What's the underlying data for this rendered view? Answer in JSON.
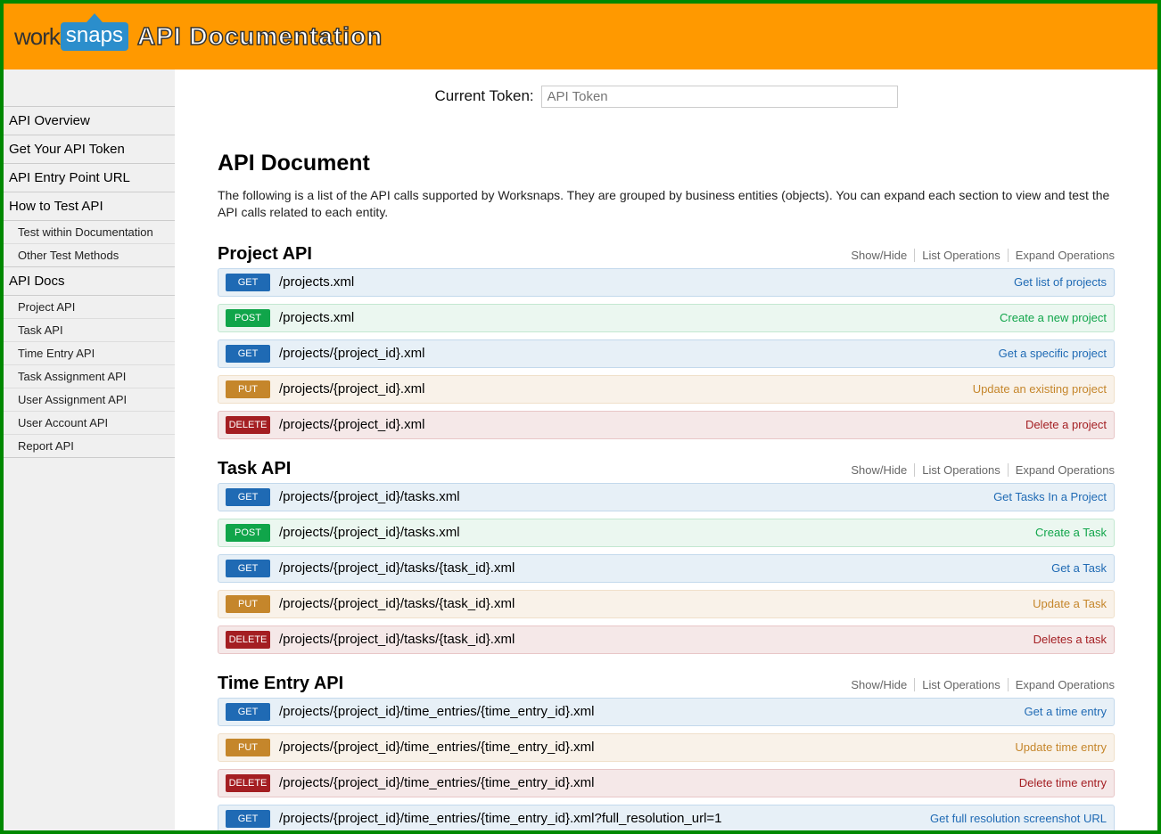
{
  "header": {
    "logo_left": "work",
    "logo_right": "snaps",
    "title": "API Documentation"
  },
  "sidebar": {
    "items": [
      {
        "type": "main",
        "label": "API Overview"
      },
      {
        "type": "main",
        "label": "Get Your API Token"
      },
      {
        "type": "main",
        "label": "API Entry Point URL"
      },
      {
        "type": "main",
        "label": "How to Test API"
      },
      {
        "type": "sub",
        "label": "Test within Documentation"
      },
      {
        "type": "sub",
        "label": "Other Test Methods"
      },
      {
        "type": "main",
        "label": "API Docs"
      },
      {
        "type": "sub",
        "label": "Project API"
      },
      {
        "type": "sub",
        "label": "Task API"
      },
      {
        "type": "sub",
        "label": "Time Entry API"
      },
      {
        "type": "sub",
        "label": "Task Assignment API"
      },
      {
        "type": "sub",
        "label": "User Assignment API"
      },
      {
        "type": "sub",
        "label": "User Account API"
      },
      {
        "type": "sub",
        "label": "Report API"
      }
    ]
  },
  "token": {
    "label": "Current Token:",
    "placeholder": "API Token"
  },
  "page": {
    "title": "API Document",
    "intro": "The following is a list of the API calls supported by Worksnaps. They are grouped by business entities (objects). You can expand each section to view and test the API calls related to each entity."
  },
  "ops": {
    "showhide": "Show/Hide",
    "list": "List Operations",
    "expand": "Expand Operations"
  },
  "sections": [
    {
      "title": "Project API",
      "endpoints": [
        {
          "method": "GET",
          "path": "/projects.xml",
          "desc": "Get list of projects"
        },
        {
          "method": "POST",
          "path": "/projects.xml",
          "desc": "Create a new project"
        },
        {
          "method": "GET",
          "path": "/projects/{project_id}.xml",
          "desc": "Get a specific project"
        },
        {
          "method": "PUT",
          "path": "/projects/{project_id}.xml",
          "desc": "Update an existing project"
        },
        {
          "method": "DELETE",
          "path": "/projects/{project_id}.xml",
          "desc": "Delete a project"
        }
      ]
    },
    {
      "title": "Task API",
      "endpoints": [
        {
          "method": "GET",
          "path": "/projects/{project_id}/tasks.xml",
          "desc": "Get Tasks In a Project"
        },
        {
          "method": "POST",
          "path": "/projects/{project_id}/tasks.xml",
          "desc": "Create a Task"
        },
        {
          "method": "GET",
          "path": "/projects/{project_id}/tasks/{task_id}.xml",
          "desc": "Get a Task"
        },
        {
          "method": "PUT",
          "path": "/projects/{project_id}/tasks/{task_id}.xml",
          "desc": "Update a Task"
        },
        {
          "method": "DELETE",
          "path": "/projects/{project_id}/tasks/{task_id}.xml",
          "desc": "Deletes a task"
        }
      ]
    },
    {
      "title": "Time Entry API",
      "endpoints": [
        {
          "method": "GET",
          "path": "/projects/{project_id}/time_entries/{time_entry_id}.xml",
          "desc": "Get a time entry"
        },
        {
          "method": "PUT",
          "path": "/projects/{project_id}/time_entries/{time_entry_id}.xml",
          "desc": "Update time entry"
        },
        {
          "method": "DELETE",
          "path": "/projects/{project_id}/time_entries/{time_entry_id}.xml",
          "desc": "Delete time entry"
        },
        {
          "method": "GET",
          "path": "/projects/{project_id}/time_entries/{time_entry_id}.xml?full_resolution_url=1",
          "desc": "Get full resolution screenshot URL"
        }
      ]
    }
  ]
}
